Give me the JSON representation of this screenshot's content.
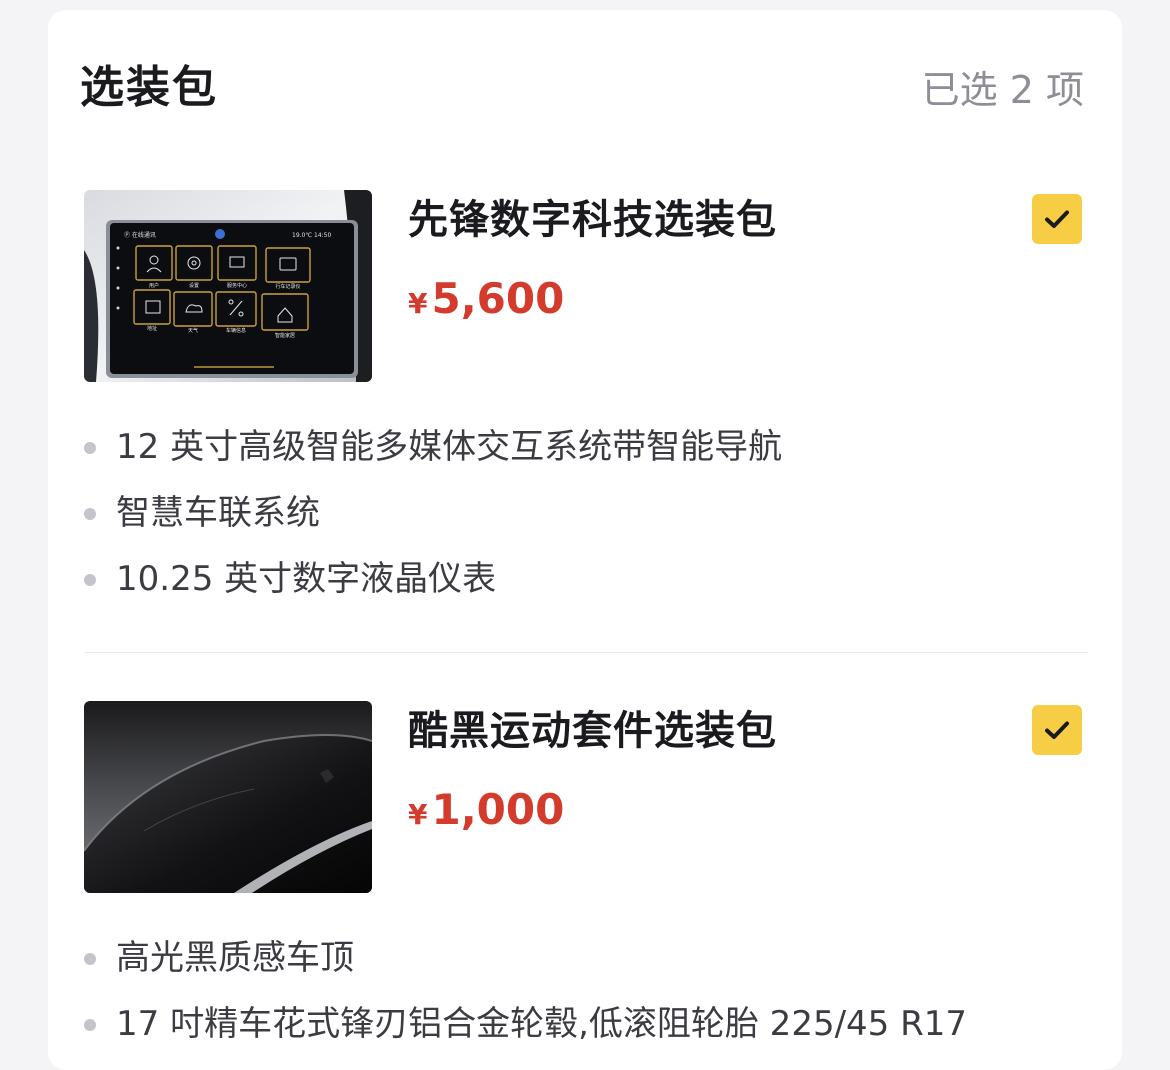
{
  "header": {
    "title": "选装包",
    "selected_count": "已选 2 项"
  },
  "packages": [
    {
      "name": "先锋数字科技选装包",
      "currency": "¥",
      "price": "5,600",
      "checked": true,
      "image_icon": "infotainment-screen-image",
      "screen": {
        "status_left": "Ⓟ 在线通讯",
        "status_right": "19.0℃   14:50",
        "tiles": [
          "用户",
          "设置",
          "服务中心",
          "行车记录仪",
          "地址",
          "天气",
          "车辆信息",
          "智能家居"
        ]
      },
      "features": [
        "12 英寸高级智能多媒体交互系统带智能导航",
        "智慧车联系统",
        "10.25 英寸数字液晶仪表"
      ]
    },
    {
      "name": "酷黑运动套件选装包",
      "currency": "¥",
      "price": "1,000",
      "checked": true,
      "image_icon": "black-roof-image",
      "features": [
        "高光黑质感车顶",
        "17 吋精车花式锋刃铝合金轮毂,低滚阻轮胎 225/45 R17"
      ]
    }
  ],
  "colors": {
    "accent_yellow": "#f6cd45",
    "price_red": "#d33b2c",
    "muted_text": "#8e8e96"
  }
}
